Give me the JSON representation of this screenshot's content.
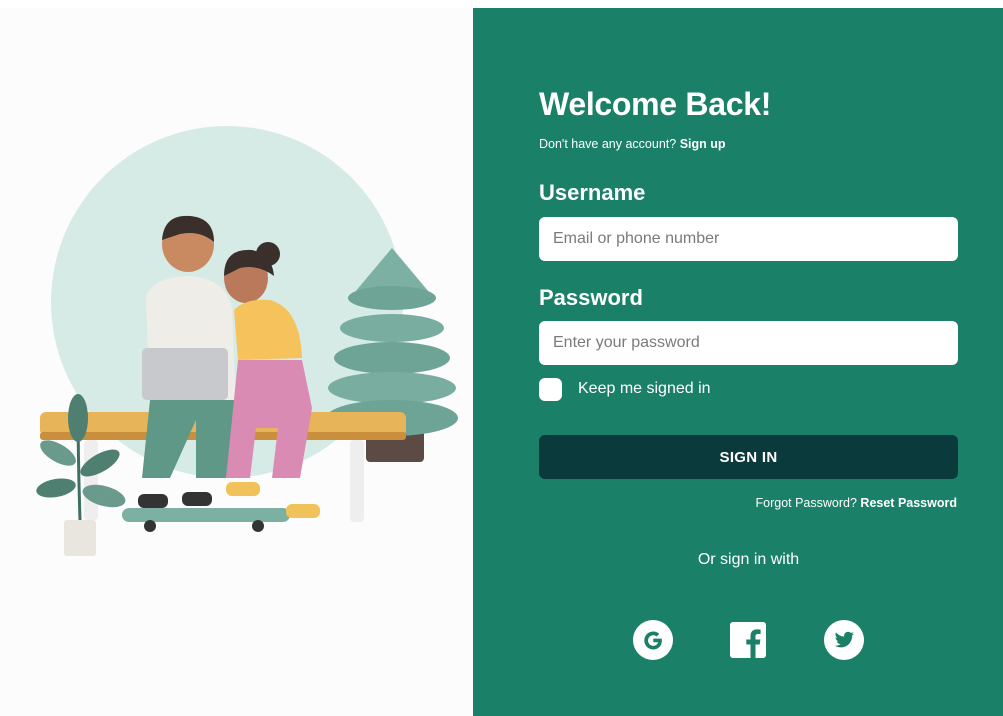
{
  "login": {
    "title": "Welcome Back!",
    "signup_prompt": "Don't have any account?",
    "signup_link": "Sign up",
    "username_label": "Username",
    "username_placeholder": "Email or phone number",
    "password_label": "Password",
    "password_placeholder": "Enter your password",
    "remember_label": "Keep me signed in",
    "remember_checked": false,
    "signin_label": "SIGN IN",
    "forgot_prompt": "Forgot Password?",
    "reset_link": "Reset Password",
    "social_prompt": "Or sign in with",
    "social": [
      "google-icon",
      "facebook-icon",
      "twitter-icon"
    ]
  },
  "colors": {
    "panel_bg": "#1a8068",
    "button_bg": "#0b3a3c",
    "circle_bg": "#d6eae6",
    "left_bg": "#fcfcfc"
  }
}
